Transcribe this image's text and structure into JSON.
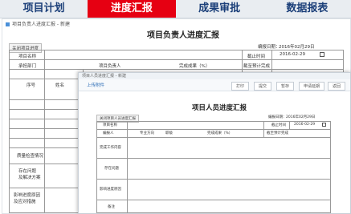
{
  "nav": {
    "tabs": [
      "项目计划",
      "进度汇报",
      "成果审批",
      "数据报表"
    ],
    "active_tab": "进度汇报"
  },
  "leader_form": {
    "breadcrumb": "项目负责人进度汇报 - 新建",
    "close_button": "关闭项目进度",
    "title": "项目负责人进度汇报",
    "report_date_label": "编报日期：",
    "report_date_value": "2016年02月29日",
    "project_name_label": "项目名称",
    "deadline_label": "截止时间",
    "deadline_value": "2016-02-29",
    "department_label": "承担部门",
    "leader_label": "项目负责人",
    "completion_label": "完成成果（%）",
    "expected_label": "截至预计完成",
    "row_no_label": "序号",
    "name_label": "姓名",
    "quality_label": "质量检查情况",
    "issues_label": "存在问题\n及解决方案",
    "impact_label": "影响进度原因\n及应对措施"
  },
  "staff_form": {
    "breadcrumb": "项目人员进度汇报 - 新建",
    "upload_label": "上传附件",
    "toolbar": [
      "打印",
      "提交",
      "暂存",
      "申请延期",
      "返回"
    ],
    "close_button": "关闭项目人员进度汇报",
    "title": "项目人员进度汇报",
    "report_date_label": "编报日期：",
    "report_date_value": "2016年02月29日",
    "project_name_label": "项目名称",
    "deadline_label": "截止时间",
    "deadline_value": "2016-02-29",
    "person_label": "编报人",
    "specialty_label": "专业方向",
    "title_label": "职级",
    "completion_label": "完成成果（%）",
    "expected_label": "截至预计完成",
    "content_label": "完成工作内容",
    "issues_label": "存在问题",
    "impact_label": "影响进度原因",
    "remark_label": "备注"
  },
  "colors": {
    "accent": "#e60012",
    "nav_text": "#1b3f79",
    "link": "#2a6bb5"
  }
}
